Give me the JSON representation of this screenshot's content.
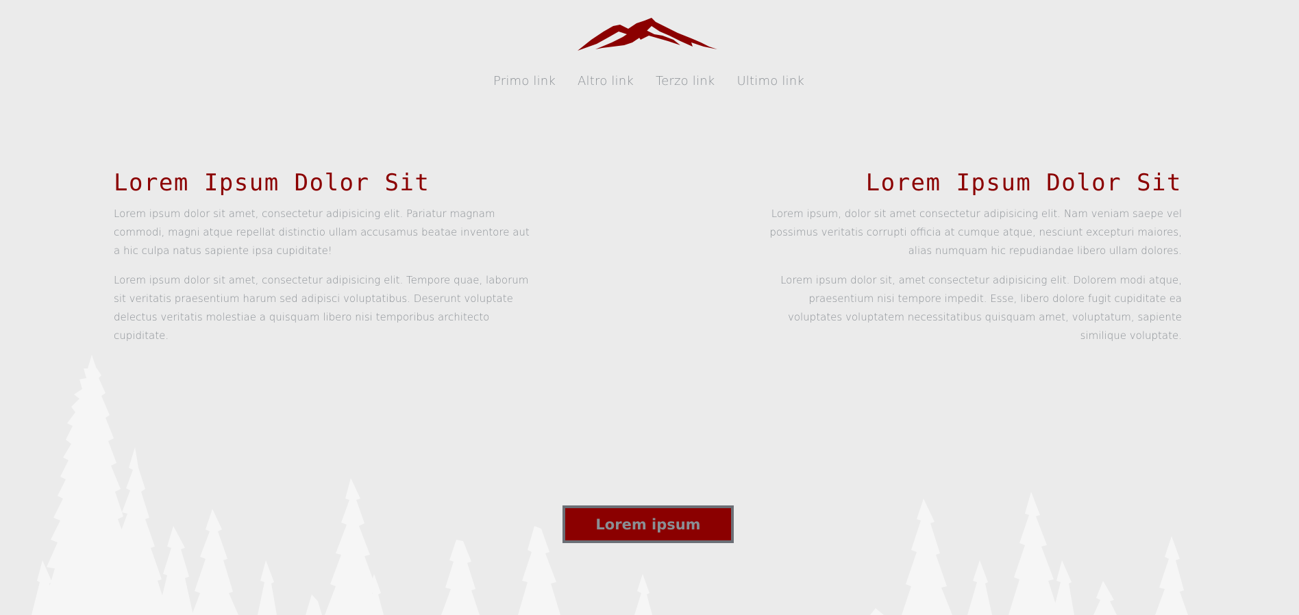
{
  "brand": {
    "logo_icon": "mountain-logo-icon",
    "accent_color": "#8b0000"
  },
  "nav": {
    "links": [
      "Primo link",
      "Altro link",
      "Terzo link",
      "Ultimo link"
    ]
  },
  "left": {
    "title": "Lorem Ipsum Dolor Sit",
    "p1": "Lorem ipsum dolor sit amet, consectetur adipisicing elit. Pariatur magnam commodi, magni atque repellat distinctio ullam accusamus beatae inventore aut a hic culpa natus sapiente ipsa cupiditate!",
    "p2": "Lorem ipsum dolor sit amet, consectetur adipisicing elit. Tempore quae, laborum sit veritatis praesentium harum sed adipisci voluptatibus. Deserunt voluptate delectus veritatis molestiae a quisquam libero nisi temporibus architecto cupiditate."
  },
  "right": {
    "title": "Lorem Ipsum Dolor Sit",
    "p1": "Lorem ipsum, dolor sit amet consectetur adipisicing elit. Nam veniam saepe vel possimus veritatis corrupti officia at cumque atque, nesciunt excepturi maiores, alias numquam hic repudiandae libero ullam dolores.",
    "p2": "Lorem ipsum dolor sit, amet consectetur adipisicing elit. Dolorem modi atque, praesentium nisi tempore impedit. Esse, libero dolore fugit cupiditate ea voluptates voluptatem necessitatibus quisquam amet, voluptatum, sapiente similique voluptate."
  },
  "cta": {
    "label": "Lorem ipsum"
  },
  "decor": {
    "background_icon": "pine-forest-silhouette-icon"
  }
}
